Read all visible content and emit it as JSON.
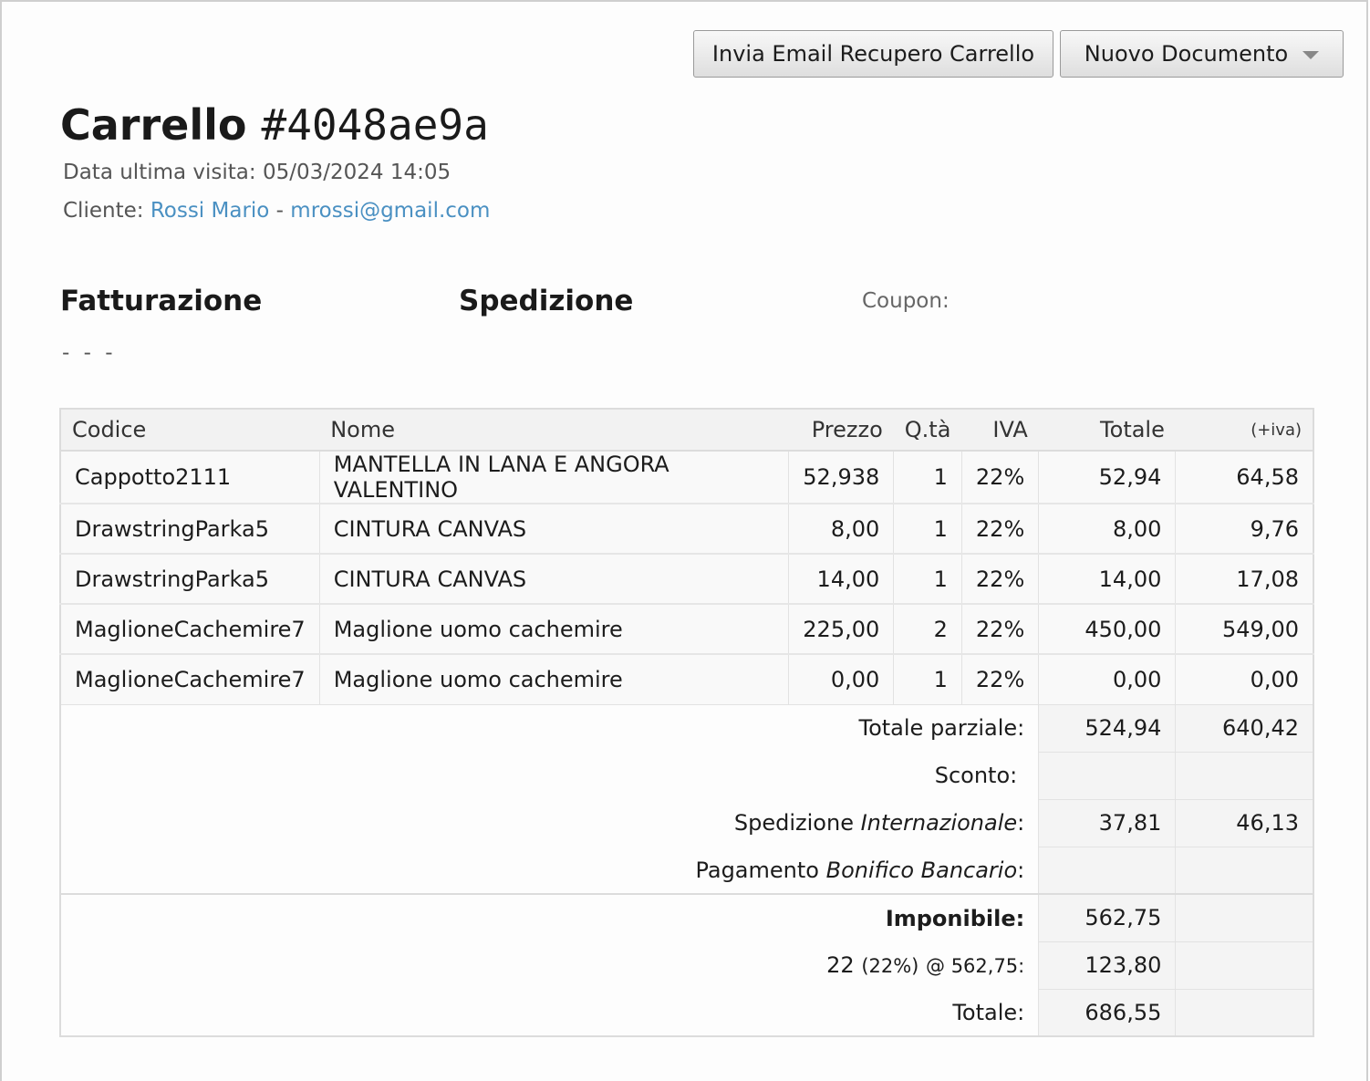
{
  "buttons": {
    "email_label": "Invia Email Recupero Carrello",
    "new_doc_label": "Nuovo Documento"
  },
  "cart": {
    "title_prefix": "Carrello ",
    "id": "#4048ae9a",
    "last_visit_label": "Data ultima visita:",
    "last_visit_value": "05/03/2024 14:05",
    "client_label": "Cliente:",
    "client_name": "Rossi Mario",
    "client_sep": "-",
    "client_email": "mrossi@gmail.com"
  },
  "sections": {
    "billing": "Fatturazione",
    "shipping": "Spedizione",
    "coupon": "Coupon:",
    "billing_value": "- - -"
  },
  "table": {
    "headers": {
      "code": "Codice",
      "name": "Nome",
      "price": "Prezzo",
      "qty": "Q.tà",
      "vat": "IVA",
      "total": "Totale",
      "plus_vat": "(+iva)"
    },
    "rows": [
      {
        "code": "Cappotto2111",
        "name": "MANTELLA IN LANA E ANGORA VALENTINO",
        "price": "52,938",
        "qty": "1",
        "vat": "22%",
        "total": "52,94",
        "total_vat": "64,58"
      },
      {
        "code": "DrawstringParka5",
        "name": "CINTURA CANVAS",
        "price": "8,00",
        "qty": "1",
        "vat": "22%",
        "total": "8,00",
        "total_vat": "9,76"
      },
      {
        "code": "DrawstringParka5",
        "name": "CINTURA CANVAS",
        "price": "14,00",
        "qty": "1",
        "vat": "22%",
        "total": "14,00",
        "total_vat": "17,08"
      },
      {
        "code": "MaglioneCachemire7",
        "name": "Maglione uomo cachemire",
        "price": "225,00",
        "qty": "2",
        "vat": "22%",
        "total": "450,00",
        "total_vat": "549,00"
      },
      {
        "code": "MaglioneCachemire7",
        "name": "Maglione uomo cachemire",
        "price": "0,00",
        "qty": "1",
        "vat": "22%",
        "total": "0,00",
        "total_vat": "0,00"
      }
    ],
    "summary": {
      "subtotal_label": "Totale parziale:",
      "subtotal": "524,94",
      "subtotal_vat": "640,42",
      "discount_label": "Sconto:",
      "shipping_label": "Spedizione",
      "shipping_method": "Internazionale",
      "shipping": "37,81",
      "shipping_vat": "46,13",
      "payment_label": "Pagamento",
      "payment_method": "Bonifico Bancario",
      "taxable_label": "Imponibile:",
      "taxable": "562,75",
      "vat_line_code": "22",
      "vat_line_rate": "(22%)",
      "vat_line_base": "@ 562,75:",
      "vat_amount": "123,80",
      "grand_total_label": "Totale:",
      "grand_total": "686,55"
    }
  }
}
